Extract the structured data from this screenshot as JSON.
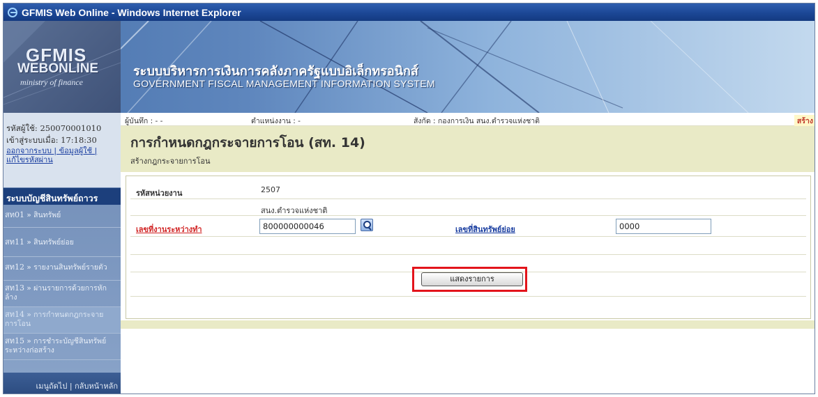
{
  "window": {
    "title": "GFMIS Web Online - Windows Internet Explorer"
  },
  "banner": {
    "logo_line1": "GFMIS",
    "logo_line2": "WEBONLINE",
    "logo_line3": "ministry of finance",
    "title_th": "ระบบบริหารการเงินการคลังภาครัฐแบบอิเล็กทรอนิกส์",
    "title_en": "GOVERNMENT FISCAL MANAGEMENT INFORMATION SYSTEM"
  },
  "user": {
    "user_id_label": "รหัสผู้ใช้: 250070001010",
    "login_label": "เข้าสู่ระบบเมื่อ: 17:18:30",
    "links": "ออกจากระบบ | ข้อมูลผู้ใช้ |",
    "change_password": "แก้ไขรหัสผ่าน"
  },
  "sidebar": {
    "heading": "ระบบบัญชีสินทรัพย์ถาวร",
    "items": [
      {
        "code": "สท01",
        "label": "» สินทรัพย์"
      },
      {
        "code": "สท11",
        "label": "» สินทรัพย์ย่อย"
      },
      {
        "code": "สท12",
        "label": "» รายงานสินทรัพย์รายตัว"
      },
      {
        "code": "สท13",
        "label": "» ผ่านรายการด้วยการหัก",
        "label2": "ล้าง"
      },
      {
        "code": "สท14",
        "label": "» การกำหนดกฎกระจาย",
        "label2": "การโอน"
      },
      {
        "code": "สท15",
        "label": "» การชำระบัญชีสินทรัพย์",
        "label2": "ระหว่างก่อสร้าง"
      }
    ],
    "footer": "เมนูถัดไป | กลับหน้าหลัก"
  },
  "info": {
    "recorder": "ผู้บันทึก : - -",
    "position": "ตำแหน่งงาน : -",
    "affiliation": "สังกัด : กองการเงิน สนง.ตำรวจแห่งชาติ",
    "status": "สร้าง"
  },
  "page": {
    "title": "การกำหนดกฎกระจายการโอน (สท. 14)",
    "subtitle": "สร้างกฎกระจายการโอน"
  },
  "form": {
    "unit_code_label": "รหัสหน่วยงาน",
    "unit_code_value": "2507",
    "unit_name": "สนง.ตำรวจแห่งชาติ",
    "wip_label": "เลขที่งานระหว่างทำ",
    "wip_value": "800000000046",
    "sub_asset_label": "เลขที่สินทรัพย์ย่อย",
    "sub_asset_value": "0000",
    "show_button": "แสดงรายการ"
  },
  "colors": {
    "title_bar": "#1c4796",
    "menu_heading": "#1c3f7c",
    "content_header_bg": "#e9eac6",
    "highlight": "#e3141b",
    "required_link": "#d12525"
  }
}
